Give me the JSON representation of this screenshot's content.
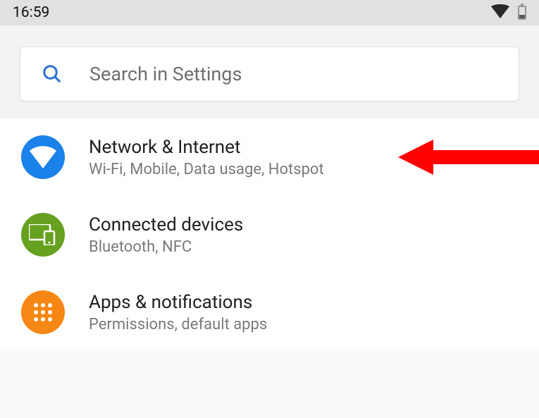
{
  "status_bar": {
    "time": "16:59"
  },
  "search": {
    "placeholder": "Search in Settings"
  },
  "settings_items": [
    {
      "id": "network",
      "title": "Network & Internet",
      "subtitle": "Wi-Fi, Mobile, Data usage, Hotspot",
      "icon": "wifi-icon",
      "color": "#1a82e8",
      "annotated": true
    },
    {
      "id": "connected",
      "title": "Connected devices",
      "subtitle": "Bluetooth, NFC",
      "icon": "devices-icon",
      "color": "#66a11f"
    },
    {
      "id": "apps",
      "title": "Apps & notifications",
      "subtitle": "Permissions, default apps",
      "icon": "apps-icon",
      "color": "#f68714"
    }
  ],
  "annotation": {
    "color": "#ff0000",
    "target_item": "network"
  }
}
